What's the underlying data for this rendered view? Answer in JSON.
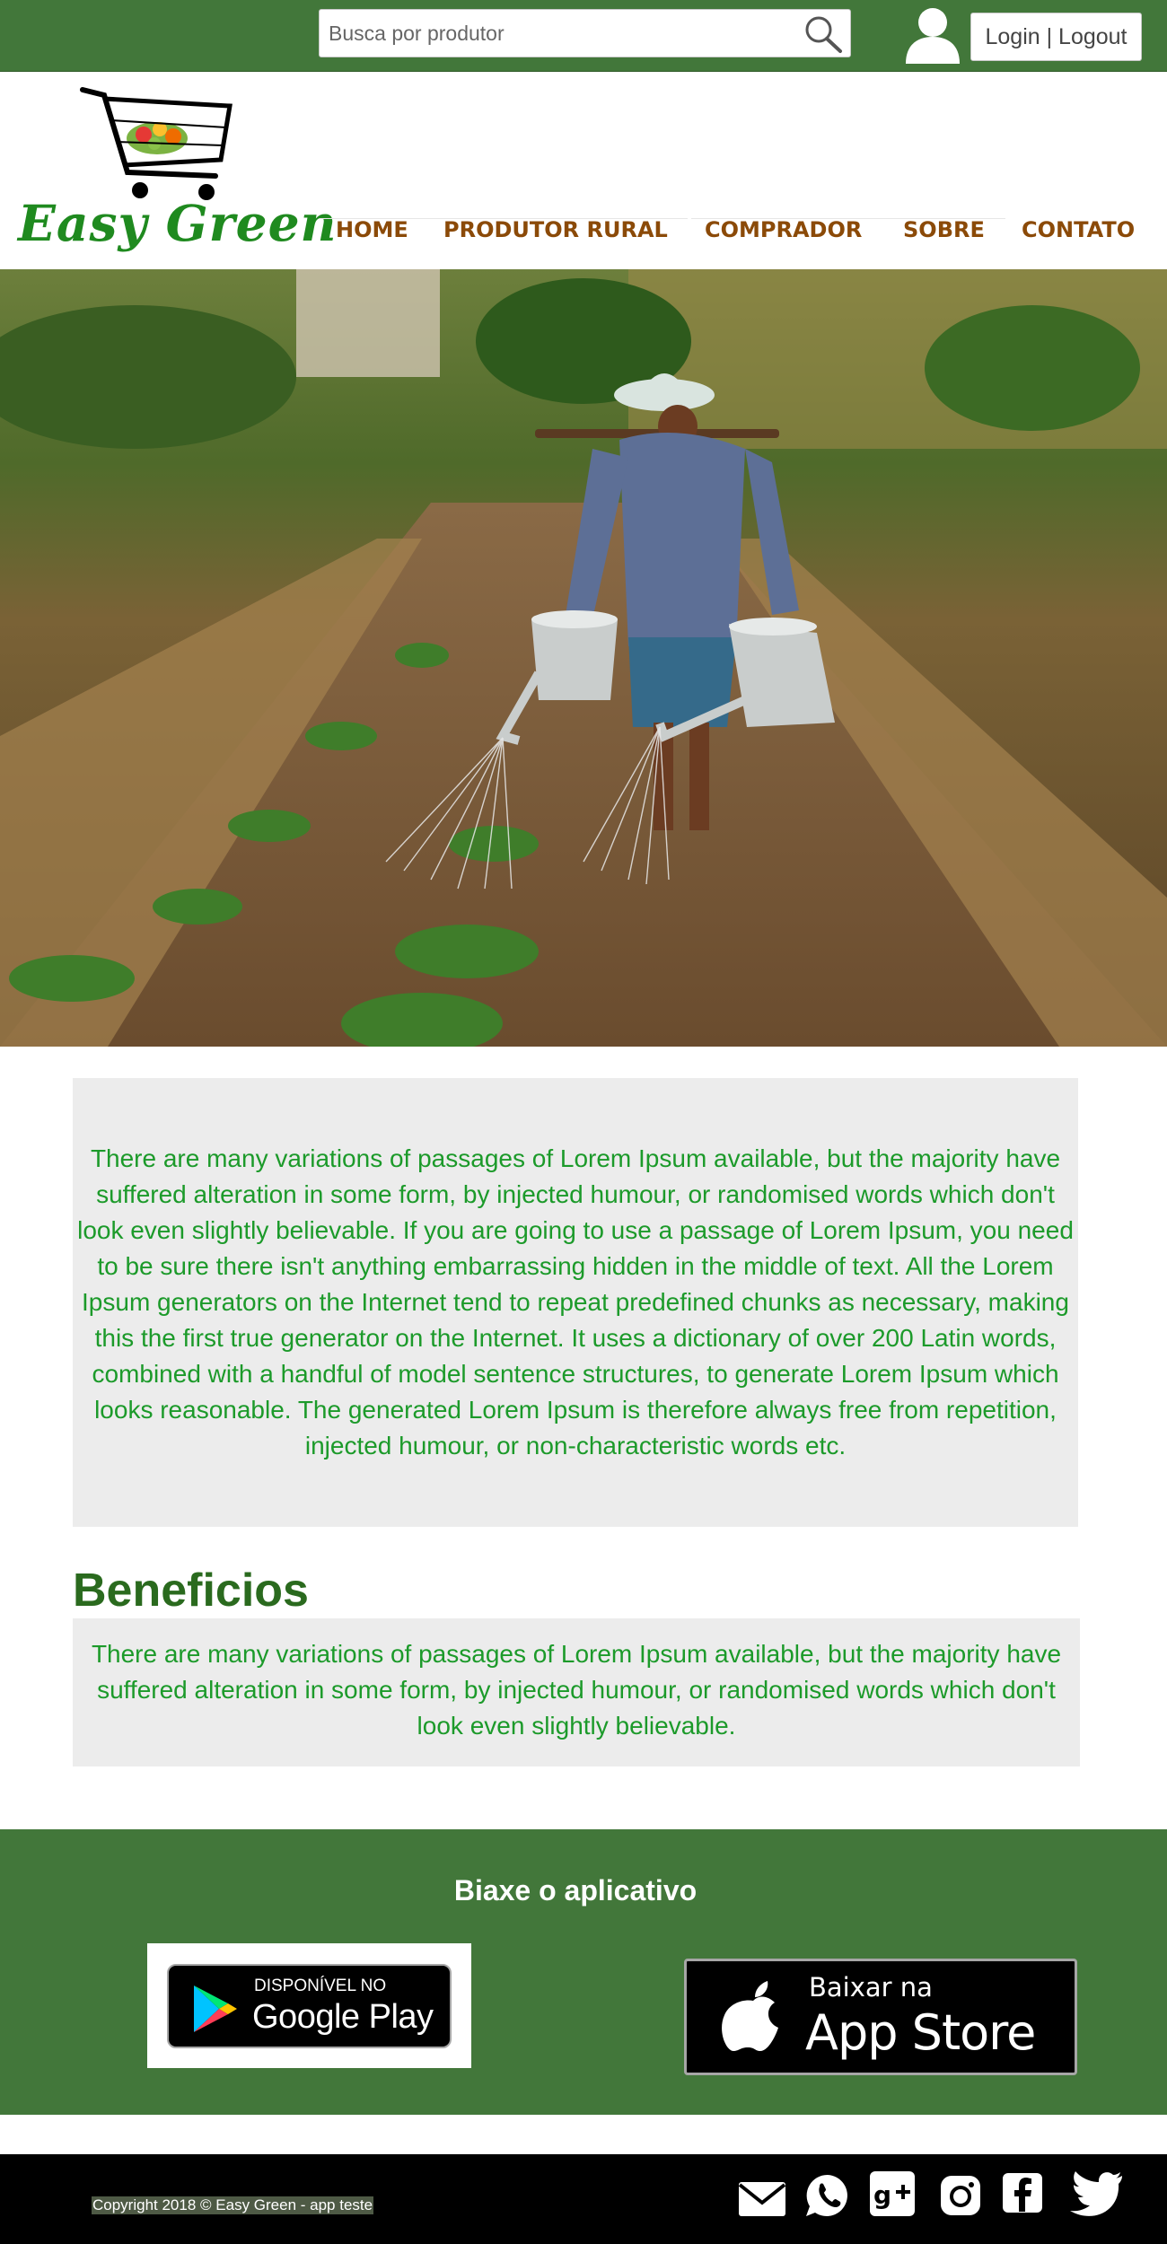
{
  "topbar": {
    "search_placeholder": "Busca por produtor",
    "login_label": "Login | Logout"
  },
  "brand": {
    "name": "Easy Green"
  },
  "nav": {
    "items": [
      {
        "label": "HOME"
      },
      {
        "label": "PRODUTOR RURAL"
      },
      {
        "label": "COMPRADOR"
      },
      {
        "label": "SOBRE"
      },
      {
        "label": "CONTATO"
      }
    ]
  },
  "intro": {
    "text": "There are many variations of passages of Lorem Ipsum available, but the majority have suffered alteration in some form, by injected humour, or randomised words which don't look even slightly believable. If you are going to use a passage of Lorem Ipsum, you need to be sure there isn't anything embarrassing hidden in the middle of text. All the Lorem Ipsum generators on the Internet tend to repeat predefined chunks as necessary, making this the first true generator on the Internet. It uses a dictionary of over 200 Latin words, combined with a handful of model sentence structures, to generate Lorem Ipsum which looks reasonable. The generated Lorem Ipsum is therefore always free from repetition, injected humour, or non-characteristic words etc."
  },
  "benefits": {
    "title": "Beneficios",
    "text": "There are many variations of passages of Lorem Ipsum available, but the majority have suffered alteration in some form, by injected humour, or randomised words which don't look even slightly believable."
  },
  "app": {
    "title": "Biaxe o aplicativo",
    "google_play": {
      "small": "DISPONÍVEL NO",
      "big": "Google Play"
    },
    "app_store": {
      "small": "Baixar na",
      "big": "App Store"
    }
  },
  "footer": {
    "copyright": "Copyright 2018 © Easy Green - app teste",
    "social": [
      "mail-icon",
      "whatsapp-icon",
      "google-plus-icon",
      "instagram-icon",
      "facebook-icon",
      "twitter-icon"
    ]
  },
  "colors": {
    "brand_green": "#42773a",
    "text_green": "#1c9a2a",
    "nav_brown": "#8b4a08",
    "heading_green": "#2a6a1e"
  }
}
